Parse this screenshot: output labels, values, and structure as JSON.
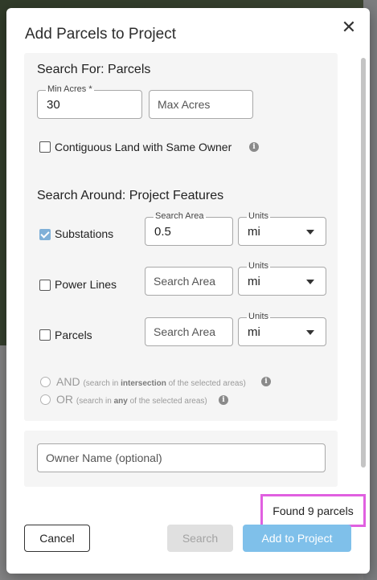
{
  "modal": {
    "title": "Add Parcels to Project",
    "close_icon": "close-icon"
  },
  "search_for": {
    "title": "Search For: Parcels",
    "min_acres_label": "Min Acres *",
    "min_acres_value": "30",
    "max_acres_placeholder": "Max Acres",
    "contiguous_label": "Contiguous Land with Same Owner",
    "contiguous_checked": false
  },
  "search_around": {
    "title": "Search Around: Project Features",
    "features": [
      {
        "label": "Substations",
        "checked": true,
        "area_label": "Search Area",
        "area_value": "0.5",
        "units_label": "Units",
        "units_value": "mi"
      },
      {
        "label": "Power Lines",
        "checked": false,
        "area_placeholder": "Search Area",
        "units_label": "Units",
        "units_value": "mi"
      },
      {
        "label": "Parcels",
        "checked": false,
        "area_placeholder": "Search Area",
        "units_label": "Units",
        "units_value": "mi"
      }
    ],
    "mode_and": {
      "label": "AND",
      "hint_pre": "(search in ",
      "hint_bold": "intersection",
      "hint_post": " of the selected areas)"
    },
    "mode_or": {
      "label": "OR",
      "hint_pre": "(search in ",
      "hint_bold": "any",
      "hint_post": " of the selected areas)"
    }
  },
  "owner": {
    "placeholder": "Owner Name (optional)"
  },
  "status": {
    "found_text": "Found 9 parcels"
  },
  "footer": {
    "cancel_label": "Cancel",
    "search_label": "Search",
    "add_label": "Add to Project"
  },
  "colors": {
    "accent": "#7fc0ea",
    "highlight": "#e060e0",
    "checked": "#7fb0d8"
  }
}
